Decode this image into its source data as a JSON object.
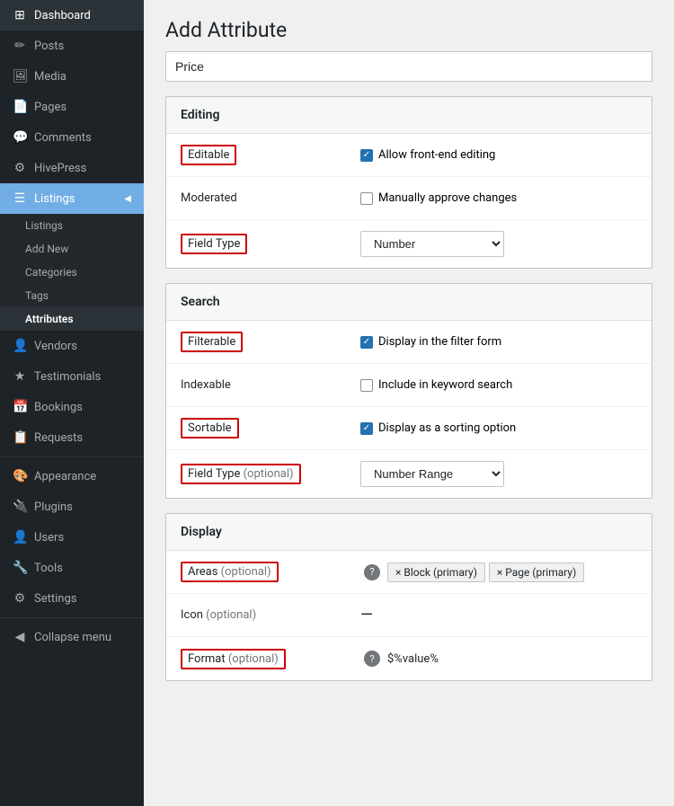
{
  "sidebar": {
    "items": [
      {
        "id": "dashboard",
        "label": "Dashboard",
        "icon": "⊞"
      },
      {
        "id": "posts",
        "label": "Posts",
        "icon": "✏"
      },
      {
        "id": "media",
        "label": "Media",
        "icon": "🖼"
      },
      {
        "id": "pages",
        "label": "Pages",
        "icon": "📄"
      },
      {
        "id": "comments",
        "label": "Comments",
        "icon": "💬"
      },
      {
        "id": "hivepress",
        "label": "HivePress",
        "icon": "⚙"
      },
      {
        "id": "listings",
        "label": "Listings",
        "icon": "☰",
        "active": true
      },
      {
        "id": "vendors",
        "label": "Vendors",
        "icon": "👤"
      },
      {
        "id": "testimonials",
        "label": "Testimonials",
        "icon": "★"
      },
      {
        "id": "bookings",
        "label": "Bookings",
        "icon": "📅"
      },
      {
        "id": "requests",
        "label": "Requests",
        "icon": "📋"
      },
      {
        "id": "appearance",
        "label": "Appearance",
        "icon": "🎨"
      },
      {
        "id": "plugins",
        "label": "Plugins",
        "icon": "🔌"
      },
      {
        "id": "users",
        "label": "Users",
        "icon": "👤"
      },
      {
        "id": "tools",
        "label": "Tools",
        "icon": "🔧"
      },
      {
        "id": "settings",
        "label": "Settings",
        "icon": "⚙"
      },
      {
        "id": "collapse",
        "label": "Collapse menu",
        "icon": "◀"
      }
    ],
    "submenu": {
      "listings": [
        {
          "id": "listings-sub",
          "label": "Listings"
        },
        {
          "id": "add-new",
          "label": "Add New"
        },
        {
          "id": "categories",
          "label": "Categories"
        },
        {
          "id": "tags",
          "label": "Tags"
        },
        {
          "id": "attributes",
          "label": "Attributes",
          "active": true
        }
      ]
    }
  },
  "page": {
    "title": "Add Attribute",
    "name_placeholder": "Price",
    "name_value": "Price"
  },
  "sections": {
    "editing": {
      "title": "Editing",
      "rows": [
        {
          "id": "editable",
          "label": "Editable",
          "highlighted": true,
          "control_type": "checkbox",
          "checked": true,
          "checkbox_label": "Allow front-end editing"
        },
        {
          "id": "moderated",
          "label": "Moderated",
          "highlighted": false,
          "control_type": "checkbox",
          "checked": false,
          "checkbox_label": "Manually approve changes"
        },
        {
          "id": "field-type-editing",
          "label": "Field Type",
          "highlighted": true,
          "control_type": "select",
          "select_value": "Number"
        }
      ]
    },
    "search": {
      "title": "Search",
      "rows": [
        {
          "id": "filterable",
          "label": "Filterable",
          "highlighted": true,
          "control_type": "checkbox",
          "checked": true,
          "checkbox_label": "Display in the filter form"
        },
        {
          "id": "indexable",
          "label": "Indexable",
          "highlighted": false,
          "control_type": "checkbox",
          "checked": false,
          "checkbox_label": "Include in keyword search"
        },
        {
          "id": "sortable",
          "label": "Sortable",
          "highlighted": true,
          "control_type": "checkbox",
          "checked": true,
          "checkbox_label": "Display as a sorting option"
        },
        {
          "id": "field-type-search",
          "label": "Field Type",
          "label_optional": " (optional)",
          "highlighted": true,
          "control_type": "select",
          "select_value": "Number Range"
        }
      ]
    },
    "display": {
      "title": "Display",
      "rows": [
        {
          "id": "areas",
          "label": "Areas",
          "label_optional": " (optional)",
          "highlighted": true,
          "control_type": "tags",
          "has_help": true,
          "tags": [
            {
              "label": "× Block (primary)"
            },
            {
              "label": "× Page (primary)"
            }
          ]
        },
        {
          "id": "icon",
          "label": "Icon",
          "label_optional": " (optional)",
          "highlighted": false,
          "control_type": "dash"
        },
        {
          "id": "format",
          "label": "Format",
          "label_optional": " (optional)",
          "highlighted": true,
          "control_type": "text",
          "has_help": true,
          "text_value": "$%value%"
        }
      ]
    }
  }
}
